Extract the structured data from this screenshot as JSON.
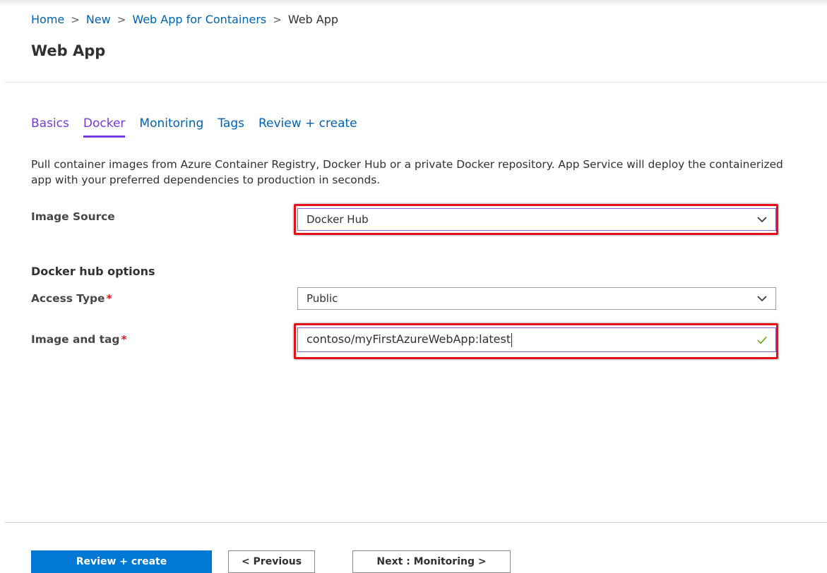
{
  "breadcrumb": [
    {
      "label": "Home"
    },
    {
      "label": "New"
    },
    {
      "label": "Web App for Containers"
    },
    {
      "label": "Web App"
    }
  ],
  "page_title": "Web App",
  "tabs": [
    {
      "label": "Basics",
      "state": "visited"
    },
    {
      "label": "Docker",
      "state": "active"
    },
    {
      "label": "Monitoring",
      "state": "default"
    },
    {
      "label": "Tags",
      "state": "default"
    },
    {
      "label": "Review + create",
      "state": "default"
    }
  ],
  "description": "Pull container images from Azure Container Registry, Docker Hub or a private Docker repository. App Service will deploy the containerized app with your preferred dependencies to production in seconds.",
  "form": {
    "image_source": {
      "label": "Image Source",
      "value": "Docker Hub",
      "icon": "chevron-down-icon"
    },
    "section_heading": "Docker hub options",
    "access_type": {
      "label": "Access Type",
      "required_mark": "*",
      "value": "Public",
      "icon": "chevron-down-icon"
    },
    "image_and_tag": {
      "label": "Image and tag",
      "required_mark": "*",
      "value": "contoso/myFirstAzureWebApp:latest",
      "icon": "checkmark-icon"
    }
  },
  "footer": {
    "review_create": "Review + create",
    "previous": "< Previous",
    "next": "Next : Monitoring >"
  },
  "colors": {
    "link": "#0063b1",
    "visited_tab": "#773adc",
    "primary_button": "#0078d4",
    "highlight_box": "#e4111b",
    "valid_check": "#57a300"
  }
}
